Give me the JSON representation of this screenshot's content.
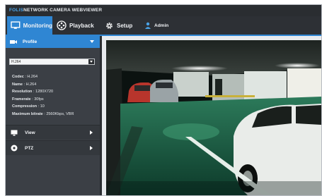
{
  "app": {
    "brand_logo": "FOLIS",
    "brand_title": "NETWORK CAMERA WEBVIEWER"
  },
  "nav": {
    "tabs": [
      {
        "label": "Monitoring",
        "icon": "monitor-icon",
        "active": true
      },
      {
        "label": "Playback",
        "icon": "film-reel-icon",
        "active": false
      },
      {
        "label": "Setup",
        "icon": "gear-icon",
        "active": false
      },
      {
        "label": "Admin",
        "icon": "user-icon",
        "active": false
      }
    ]
  },
  "sidebar": {
    "profile": {
      "title": "Profile",
      "icon": "camera-icon",
      "selected_stream": "H.264",
      "fields": [
        {
          "label": "Codec",
          "value": "H.264"
        },
        {
          "label": "Name",
          "value": "H.264"
        },
        {
          "label": "Resolution",
          "value": "1280X720"
        },
        {
          "label": "Framerate",
          "value": "30fps"
        },
        {
          "label": "Compression",
          "value": "10"
        },
        {
          "label": "Maximum bitrate",
          "value": "2560Kbps, VBR"
        }
      ]
    },
    "sections": [
      {
        "label": "View",
        "icon": "display-icon"
      },
      {
        "label": "PTZ",
        "icon": "ptz-icon"
      }
    ]
  },
  "colors": {
    "accent": "#2f86d3",
    "sidebar_bg": "#3b3f45",
    "topbar_bg": "#2d3035"
  },
  "video": {
    "description_hidden": true
  }
}
